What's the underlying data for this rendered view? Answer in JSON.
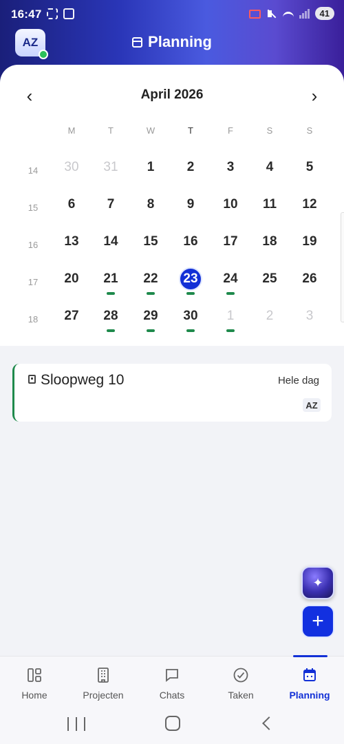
{
  "status_bar": {
    "time": "16:47",
    "battery": "41"
  },
  "header": {
    "avatar_initials": "AZ",
    "title": "Planning"
  },
  "calendar": {
    "month_label": "April 2026",
    "weekday_labels": [
      "M",
      "T",
      "W",
      "T",
      "F",
      "S",
      "S"
    ],
    "today_weekday_index": 3,
    "weeks": [
      {
        "number": "14",
        "days": [
          {
            "label": "30",
            "muted": true,
            "event": false
          },
          {
            "label": "31",
            "muted": true,
            "event": false
          },
          {
            "label": "1",
            "muted": false,
            "event": false
          },
          {
            "label": "2",
            "muted": false,
            "event": false
          },
          {
            "label": "3",
            "muted": false,
            "event": false
          },
          {
            "label": "4",
            "muted": false,
            "event": false
          },
          {
            "label": "5",
            "muted": false,
            "event": false
          }
        ]
      },
      {
        "number": "15",
        "days": [
          {
            "label": "6",
            "muted": false,
            "event": false
          },
          {
            "label": "7",
            "muted": false,
            "event": false
          },
          {
            "label": "8",
            "muted": false,
            "event": false
          },
          {
            "label": "9",
            "muted": false,
            "event": false
          },
          {
            "label": "10",
            "muted": false,
            "event": false
          },
          {
            "label": "11",
            "muted": false,
            "event": false
          },
          {
            "label": "12",
            "muted": false,
            "event": false
          }
        ]
      },
      {
        "number": "16",
        "days": [
          {
            "label": "13",
            "muted": false,
            "event": false
          },
          {
            "label": "14",
            "muted": false,
            "event": false
          },
          {
            "label": "15",
            "muted": false,
            "event": false
          },
          {
            "label": "16",
            "muted": false,
            "event": false
          },
          {
            "label": "17",
            "muted": false,
            "event": false
          },
          {
            "label": "18",
            "muted": false,
            "event": false
          },
          {
            "label": "19",
            "muted": false,
            "event": false
          }
        ]
      },
      {
        "number": "17",
        "days": [
          {
            "label": "20",
            "muted": false,
            "event": false
          },
          {
            "label": "21",
            "muted": false,
            "event": true
          },
          {
            "label": "22",
            "muted": false,
            "event": true
          },
          {
            "label": "23",
            "muted": false,
            "event": true,
            "selected": true
          },
          {
            "label": "24",
            "muted": false,
            "event": true
          },
          {
            "label": "25",
            "muted": false,
            "event": false
          },
          {
            "label": "26",
            "muted": false,
            "event": false
          }
        ]
      },
      {
        "number": "18",
        "days": [
          {
            "label": "27",
            "muted": false,
            "event": false
          },
          {
            "label": "28",
            "muted": false,
            "event": true
          },
          {
            "label": "29",
            "muted": false,
            "event": true
          },
          {
            "label": "30",
            "muted": false,
            "event": true
          },
          {
            "label": "1",
            "muted": true,
            "event": true
          },
          {
            "label": "2",
            "muted": true,
            "event": false
          },
          {
            "label": "3",
            "muted": true,
            "event": false
          }
        ]
      }
    ]
  },
  "events": [
    {
      "title": "Sloopweg 10",
      "time": "Hele dag",
      "assignee": "AZ",
      "icon": "building-icon"
    }
  ],
  "bottom_nav": {
    "active_index": 4,
    "items": [
      {
        "label": "Home",
        "icon": "dashboard-icon"
      },
      {
        "label": "Projecten",
        "icon": "building-icon"
      },
      {
        "label": "Chats",
        "icon": "chat-icon"
      },
      {
        "label": "Taken",
        "icon": "check-circle-icon"
      },
      {
        "label": "Planning",
        "icon": "calendar-icon"
      }
    ]
  },
  "colors": {
    "accent": "#1230d6",
    "event_marker": "#1f8a4c"
  }
}
